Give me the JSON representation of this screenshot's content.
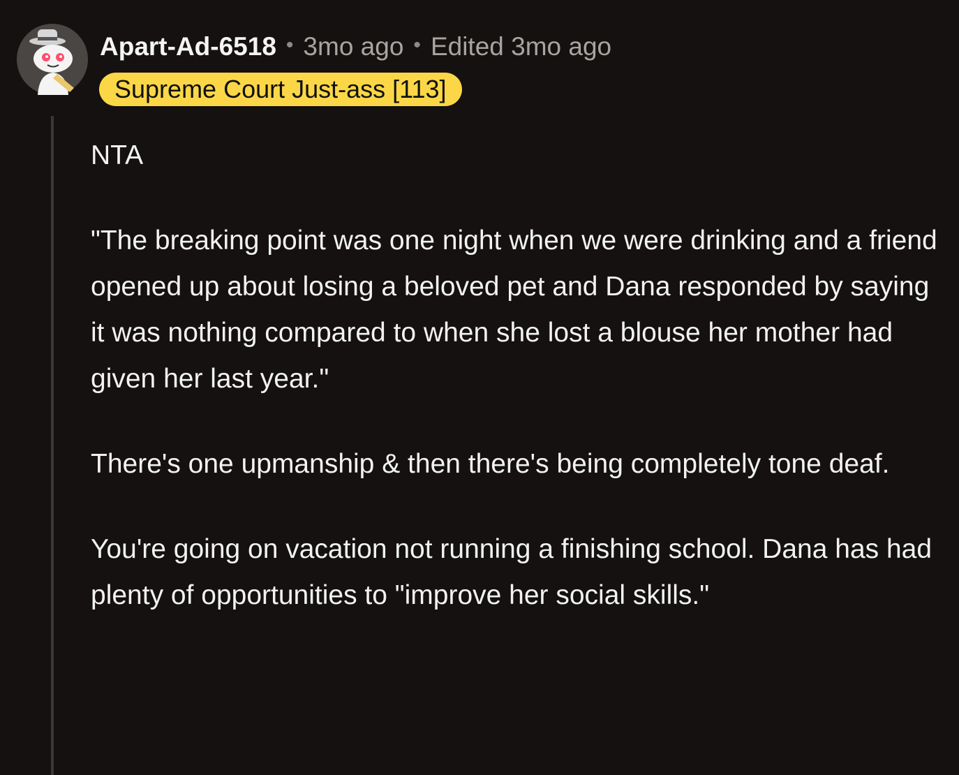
{
  "comment": {
    "username": "Apart-Ad-6518",
    "separator": "•",
    "time_ago": "3mo ago",
    "edited": "Edited 3mo ago",
    "flair": "Supreme Court Just-ass [113]",
    "avatar_icon": "snoo-avatar-icon",
    "paragraphs": [
      "NTA",
      "\"The breaking point was one night when we were drinking and a friend opened up about losing a beloved pet and Dana responded by saying it was nothing compared to when she lost a blouse her mother had given her last year.\"",
      "There's one upmanship & then there's being completely tone deaf.",
      "You're going on vacation not running a finishing school. Dana has had plenty of opportunities to \"improve her social skills.\""
    ]
  },
  "colors": {
    "background": "#141110",
    "flair_bg": "#fbd747",
    "text": "#f2f2f2",
    "meta": "#a9a4a0",
    "thread_line": "#3b3836"
  }
}
